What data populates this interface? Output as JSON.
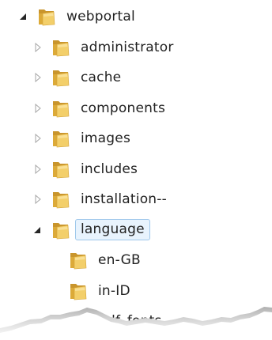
{
  "tree": {
    "root": {
      "label": "webportal",
      "expanded": true
    },
    "children": [
      {
        "label": "administrator",
        "expandable": true,
        "expanded": false
      },
      {
        "label": "cache",
        "expandable": true,
        "expanded": false
      },
      {
        "label": "components",
        "expandable": true,
        "expanded": false
      },
      {
        "label": "images",
        "expandable": true,
        "expanded": false
      },
      {
        "label": "includes",
        "expandable": true,
        "expanded": false
      },
      {
        "label": "installation--",
        "expandable": true,
        "expanded": false
      },
      {
        "label": "language",
        "expandable": true,
        "expanded": true,
        "selected": true,
        "children": [
          {
            "label": "en-GB"
          },
          {
            "label": "in-ID"
          },
          {
            "label": "pdf_fonts"
          }
        ]
      }
    ]
  },
  "colors": {
    "folder_front": "#f3cf6a",
    "folder_back": "#dcaa38",
    "selection_bg": "#e8f3fd",
    "selection_border": "#9fc8eb"
  }
}
